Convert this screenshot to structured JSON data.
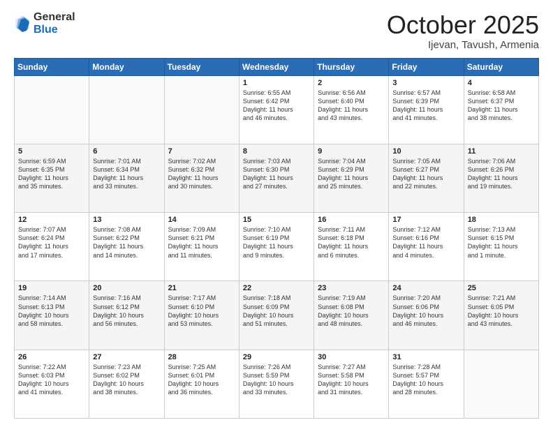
{
  "header": {
    "logo_general": "General",
    "logo_blue": "Blue",
    "title": "October 2025",
    "location": "Ijevan, Tavush, Armenia"
  },
  "days_of_week": [
    "Sunday",
    "Monday",
    "Tuesday",
    "Wednesday",
    "Thursday",
    "Friday",
    "Saturday"
  ],
  "weeks": [
    [
      {
        "day": "",
        "info": ""
      },
      {
        "day": "",
        "info": ""
      },
      {
        "day": "",
        "info": ""
      },
      {
        "day": "1",
        "info": "Sunrise: 6:55 AM\nSunset: 6:42 PM\nDaylight: 11 hours\nand 46 minutes."
      },
      {
        "day": "2",
        "info": "Sunrise: 6:56 AM\nSunset: 6:40 PM\nDaylight: 11 hours\nand 43 minutes."
      },
      {
        "day": "3",
        "info": "Sunrise: 6:57 AM\nSunset: 6:39 PM\nDaylight: 11 hours\nand 41 minutes."
      },
      {
        "day": "4",
        "info": "Sunrise: 6:58 AM\nSunset: 6:37 PM\nDaylight: 11 hours\nand 38 minutes."
      }
    ],
    [
      {
        "day": "5",
        "info": "Sunrise: 6:59 AM\nSunset: 6:35 PM\nDaylight: 11 hours\nand 35 minutes."
      },
      {
        "day": "6",
        "info": "Sunrise: 7:01 AM\nSunset: 6:34 PM\nDaylight: 11 hours\nand 33 minutes."
      },
      {
        "day": "7",
        "info": "Sunrise: 7:02 AM\nSunset: 6:32 PM\nDaylight: 11 hours\nand 30 minutes."
      },
      {
        "day": "8",
        "info": "Sunrise: 7:03 AM\nSunset: 6:30 PM\nDaylight: 11 hours\nand 27 minutes."
      },
      {
        "day": "9",
        "info": "Sunrise: 7:04 AM\nSunset: 6:29 PM\nDaylight: 11 hours\nand 25 minutes."
      },
      {
        "day": "10",
        "info": "Sunrise: 7:05 AM\nSunset: 6:27 PM\nDaylight: 11 hours\nand 22 minutes."
      },
      {
        "day": "11",
        "info": "Sunrise: 7:06 AM\nSunset: 6:26 PM\nDaylight: 11 hours\nand 19 minutes."
      }
    ],
    [
      {
        "day": "12",
        "info": "Sunrise: 7:07 AM\nSunset: 6:24 PM\nDaylight: 11 hours\nand 17 minutes."
      },
      {
        "day": "13",
        "info": "Sunrise: 7:08 AM\nSunset: 6:22 PM\nDaylight: 11 hours\nand 14 minutes."
      },
      {
        "day": "14",
        "info": "Sunrise: 7:09 AM\nSunset: 6:21 PM\nDaylight: 11 hours\nand 11 minutes."
      },
      {
        "day": "15",
        "info": "Sunrise: 7:10 AM\nSunset: 6:19 PM\nDaylight: 11 hours\nand 9 minutes."
      },
      {
        "day": "16",
        "info": "Sunrise: 7:11 AM\nSunset: 6:18 PM\nDaylight: 11 hours\nand 6 minutes."
      },
      {
        "day": "17",
        "info": "Sunrise: 7:12 AM\nSunset: 6:16 PM\nDaylight: 11 hours\nand 4 minutes."
      },
      {
        "day": "18",
        "info": "Sunrise: 7:13 AM\nSunset: 6:15 PM\nDaylight: 11 hours\nand 1 minute."
      }
    ],
    [
      {
        "day": "19",
        "info": "Sunrise: 7:14 AM\nSunset: 6:13 PM\nDaylight: 10 hours\nand 58 minutes."
      },
      {
        "day": "20",
        "info": "Sunrise: 7:16 AM\nSunset: 6:12 PM\nDaylight: 10 hours\nand 56 minutes."
      },
      {
        "day": "21",
        "info": "Sunrise: 7:17 AM\nSunset: 6:10 PM\nDaylight: 10 hours\nand 53 minutes."
      },
      {
        "day": "22",
        "info": "Sunrise: 7:18 AM\nSunset: 6:09 PM\nDaylight: 10 hours\nand 51 minutes."
      },
      {
        "day": "23",
        "info": "Sunrise: 7:19 AM\nSunset: 6:08 PM\nDaylight: 10 hours\nand 48 minutes."
      },
      {
        "day": "24",
        "info": "Sunrise: 7:20 AM\nSunset: 6:06 PM\nDaylight: 10 hours\nand 46 minutes."
      },
      {
        "day": "25",
        "info": "Sunrise: 7:21 AM\nSunset: 6:05 PM\nDaylight: 10 hours\nand 43 minutes."
      }
    ],
    [
      {
        "day": "26",
        "info": "Sunrise: 7:22 AM\nSunset: 6:03 PM\nDaylight: 10 hours\nand 41 minutes."
      },
      {
        "day": "27",
        "info": "Sunrise: 7:23 AM\nSunset: 6:02 PM\nDaylight: 10 hours\nand 38 minutes."
      },
      {
        "day": "28",
        "info": "Sunrise: 7:25 AM\nSunset: 6:01 PM\nDaylight: 10 hours\nand 36 minutes."
      },
      {
        "day": "29",
        "info": "Sunrise: 7:26 AM\nSunset: 5:59 PM\nDaylight: 10 hours\nand 33 minutes."
      },
      {
        "day": "30",
        "info": "Sunrise: 7:27 AM\nSunset: 5:58 PM\nDaylight: 10 hours\nand 31 minutes."
      },
      {
        "day": "31",
        "info": "Sunrise: 7:28 AM\nSunset: 5:57 PM\nDaylight: 10 hours\nand 28 minutes."
      },
      {
        "day": "",
        "info": ""
      }
    ]
  ]
}
